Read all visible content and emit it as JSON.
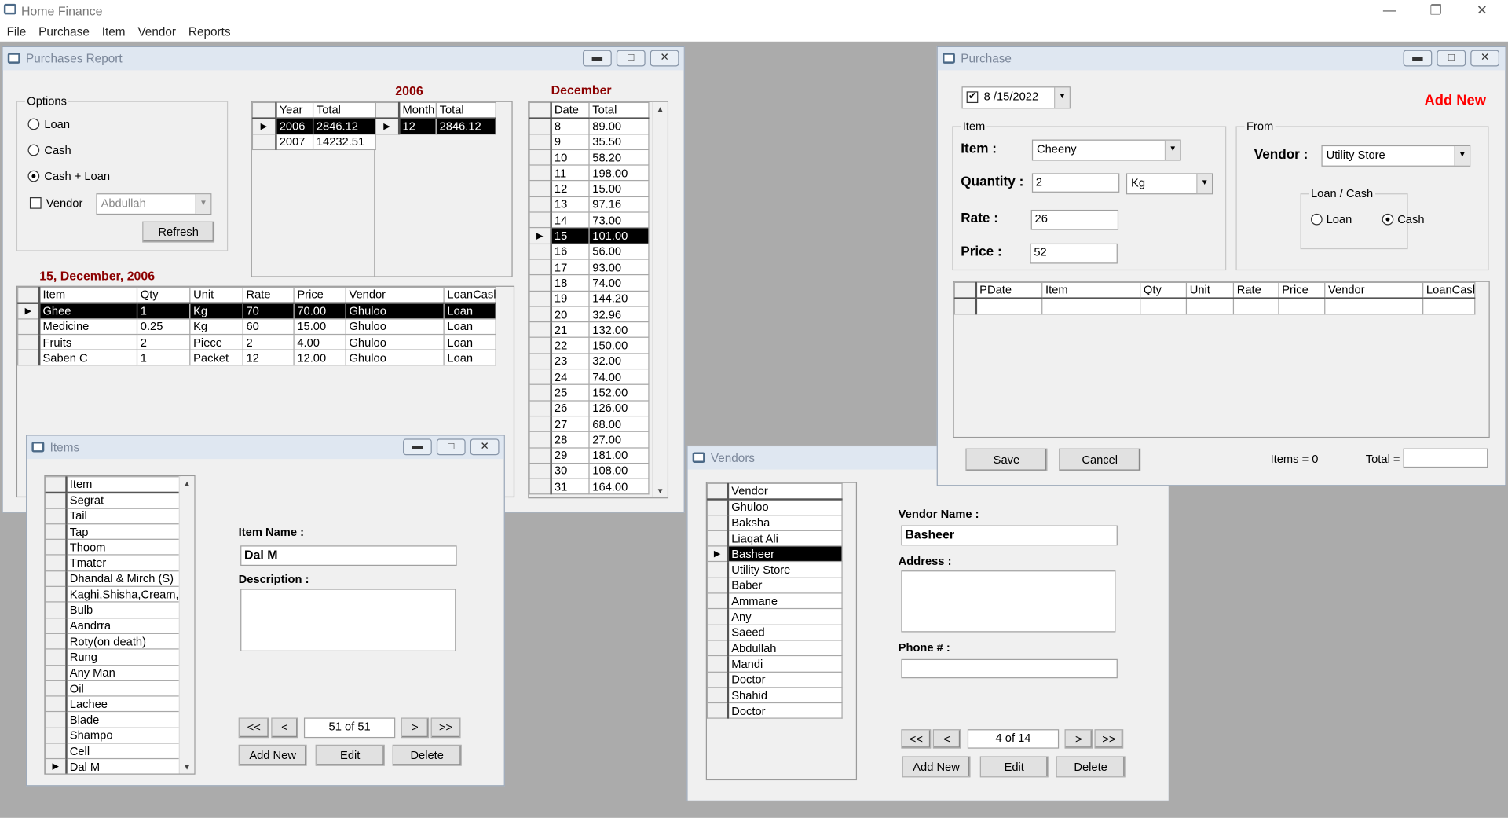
{
  "app": {
    "title": "Home Finance",
    "menu": [
      "File",
      "Purchase",
      "Item",
      "Vendor",
      "Reports"
    ]
  },
  "report": {
    "title": "Purchases Report",
    "options_label": "Options",
    "opt_loan": "Loan",
    "opt_cash": "Cash",
    "opt_both": "Cash + Loan",
    "selected_option": "Cash + Loan",
    "vendor_check": "Vendor",
    "vendor_checked": false,
    "vendor_value": "Abdullah",
    "refresh": "Refresh",
    "year_label": "2006",
    "month_label": "December",
    "day_label": "15, December, 2006",
    "year_grid": {
      "headers": [
        "Year",
        "Total"
      ],
      "rows": [
        [
          "2006",
          "2846.12"
        ],
        [
          "2007",
          "14232.51"
        ]
      ],
      "selected": 0
    },
    "month_grid": {
      "headers": [
        "Month",
        "Total"
      ],
      "rows": [
        [
          "12",
          "2846.12"
        ]
      ],
      "selected": 0
    },
    "day_grid": {
      "headers": [
        "Date",
        "Total"
      ],
      "rows": [
        [
          "8",
          "89.00"
        ],
        [
          "9",
          "35.50"
        ],
        [
          "10",
          "58.20"
        ],
        [
          "11",
          "198.00"
        ],
        [
          "12",
          "15.00"
        ],
        [
          "13",
          "97.16"
        ],
        [
          "14",
          "73.00"
        ],
        [
          "15",
          "101.00"
        ],
        [
          "16",
          "56.00"
        ],
        [
          "17",
          "93.00"
        ],
        [
          "18",
          "74.00"
        ],
        [
          "19",
          "144.20"
        ],
        [
          "20",
          "32.96"
        ],
        [
          "21",
          "132.00"
        ],
        [
          "22",
          "150.00"
        ],
        [
          "23",
          "32.00"
        ],
        [
          "24",
          "74.00"
        ],
        [
          "25",
          "152.00"
        ],
        [
          "26",
          "126.00"
        ],
        [
          "27",
          "68.00"
        ],
        [
          "28",
          "27.00"
        ],
        [
          "29",
          "181.00"
        ],
        [
          "30",
          "108.00"
        ],
        [
          "31",
          "164.00"
        ]
      ],
      "selected": 7
    },
    "item_grid": {
      "headers": [
        "Item",
        "Qty",
        "Unit",
        "Rate",
        "Price",
        "Vendor",
        "LoanCash"
      ],
      "rows": [
        [
          "Ghee",
          "1",
          "Kg",
          "70",
          "70.00",
          "Ghuloo",
          "Loan"
        ],
        [
          "Medicine",
          "0.25",
          "Kg",
          "60",
          "15.00",
          "Ghuloo",
          "Loan"
        ],
        [
          "Fruits",
          "2",
          "Piece",
          "2",
          "4.00",
          "Ghuloo",
          "Loan"
        ],
        [
          "Saben C",
          "1",
          "Packet",
          "12",
          "12.00",
          "Ghuloo",
          "Loan"
        ]
      ],
      "selected": 0
    }
  },
  "items": {
    "title": "Items",
    "list": {
      "headers": [
        "Item"
      ],
      "rows": [
        [
          "Segrat"
        ],
        [
          "Tail"
        ],
        [
          "Tap"
        ],
        [
          "Thoom"
        ],
        [
          "Tmater"
        ],
        [
          "Dhandal & Mirch (S)"
        ],
        [
          "Kaghi,Shisha,Cream,etc"
        ],
        [
          "Bulb"
        ],
        [
          "Aandrra"
        ],
        [
          "Roty(on death)"
        ],
        [
          "Rung"
        ],
        [
          "Any Man"
        ],
        [
          "Oil"
        ],
        [
          "Lachee"
        ],
        [
          "Blade"
        ],
        [
          "Shampo"
        ],
        [
          "Cell"
        ],
        [
          "Dal M"
        ]
      ],
      "selected": 17,
      "marker_only": true
    },
    "name_label": "Item Name :",
    "name_value": "Dal M",
    "desc_label": "Description :",
    "desc_value": "",
    "first": "<<",
    "prev": "<",
    "position": "51 of 51",
    "next": ">",
    "last": ">>",
    "add": "Add New",
    "edit": "Edit",
    "delete": "Delete"
  },
  "vendors": {
    "title": "Vendors",
    "list": {
      "headers": [
        "Vendor"
      ],
      "rows": [
        [
          "Ghuloo"
        ],
        [
          "Baksha"
        ],
        [
          "Liaqat Ali"
        ],
        [
          "Basheer"
        ],
        [
          "Utility Store"
        ],
        [
          "Baber"
        ],
        [
          "Ammane"
        ],
        [
          "Any"
        ],
        [
          "Saeed"
        ],
        [
          "Abdullah"
        ],
        [
          "Mandi"
        ],
        [
          "Doctor"
        ],
        [
          "Shahid"
        ],
        [
          "Doctor"
        ]
      ],
      "selected": 3
    },
    "name_label": "Vendor Name :",
    "name_value": "Basheer",
    "address_label": "Address :",
    "address_value": "",
    "phone_label": "Phone # :",
    "phone_value": "",
    "first": "<<",
    "prev": "<",
    "position": "4 of 14",
    "next": ">",
    "last": ">>",
    "add": "Add New",
    "edit": "Edit",
    "delete": "Delete"
  },
  "purchase": {
    "title": "Purchase",
    "date": "8 /15/2022",
    "date_checked": true,
    "mode": "Add New",
    "item_group": "Item",
    "item_label": "Item :",
    "item_value": "Cheeny",
    "qty_label": "Quantity :",
    "qty_value": "2",
    "unit_value": "Kg",
    "rate_label": "Rate :",
    "rate_value": "26",
    "price_label": "Price :",
    "price_value": "52",
    "from_group": "From",
    "vendor_label": "Vendor :",
    "vendor_value": "Utility Store",
    "loancash_group": "Loan / Cash",
    "opt_loan": "Loan",
    "opt_cash": "Cash",
    "selected_option": "Cash",
    "grid": {
      "headers": [
        "PDate",
        "Item",
        "Qty",
        "Unit",
        "Rate",
        "Price",
        "Vendor",
        "LoanCash"
      ],
      "rows": [
        [
          "",
          "",
          "",
          "",
          "",
          "",
          "",
          ""
        ]
      ],
      "selected": -1
    },
    "save": "Save",
    "cancel": "Cancel",
    "items_count": "Items = 0",
    "total_label": "Total =",
    "total_value": ""
  },
  "colors": {
    "accent_red": "#ff0000",
    "label_red": "#8b0000",
    "selection": "#000000",
    "mdi_background": "#ababab"
  }
}
